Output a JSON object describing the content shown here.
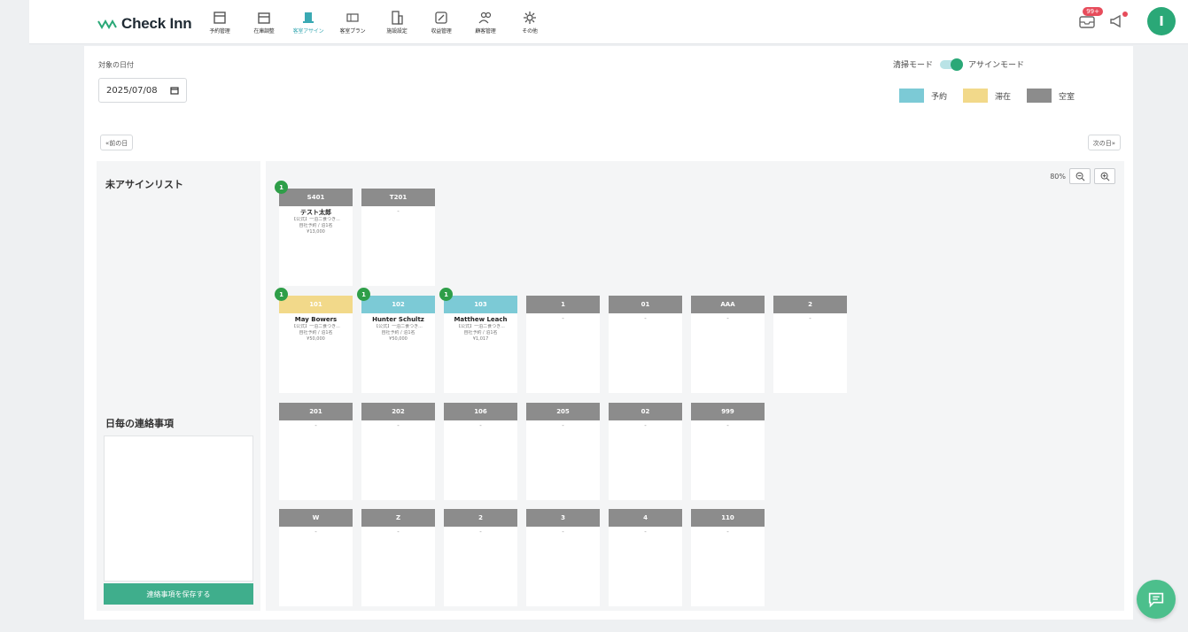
{
  "app": {
    "name": "Check Inn"
  },
  "nav": [
    {
      "label": "予約管理",
      "icon": "calendar-icon"
    },
    {
      "label": "在庫調整",
      "icon": "inventory-icon"
    },
    {
      "label": "客室アサイン",
      "icon": "room-assign-icon",
      "active": true
    },
    {
      "label": "客室プラン",
      "icon": "room-plan-icon"
    },
    {
      "label": "施設設定",
      "icon": "building-icon"
    },
    {
      "label": "収益管理",
      "icon": "revenue-icon"
    },
    {
      "label": "顧客管理",
      "icon": "customers-icon"
    },
    {
      "label": "その他",
      "icon": "gear-icon"
    }
  ],
  "header": {
    "notification_badge": "99+",
    "avatar_letter": "I"
  },
  "date": {
    "label": "対象の日付",
    "value": "2025/07/08"
  },
  "mode": {
    "left": "清掃モード",
    "right": "アサインモード"
  },
  "legend": [
    {
      "label": "予約",
      "color": "#7ccad6"
    },
    {
      "label": "滞在",
      "color": "#f2d98a"
    },
    {
      "label": "空室",
      "color": "#8c8c8c"
    }
  ],
  "nav_buttons": {
    "prev": "«前の日",
    "next": "次の日»"
  },
  "left_panel": {
    "unassigned_title": "未アサインリスト",
    "notes_title": "日毎の連絡事項",
    "save_button": "連絡事項を保存する"
  },
  "zoom": {
    "level": "80%"
  },
  "colors": {
    "reserved": "#7ccad6",
    "staying": "#f2d98a",
    "vacant": "#8c8c8c",
    "accent": "#2aa877"
  },
  "rooms": [
    [
      {
        "name": "S401",
        "status": "vacant",
        "count": "1",
        "guest": "テスト太郎",
        "l1": "【公式】一泊二食つき...",
        "l2": "自社予約 / 泊1名",
        "l3": "¥13,000"
      },
      {
        "name": "T201",
        "status": "vacant",
        "empty": "-"
      }
    ],
    [
      {
        "name": "101",
        "status": "staying",
        "count": "1",
        "guest": "May Bowers",
        "l1": "【公式】一泊二食つき...",
        "l2": "自社予約 / 泊1名",
        "l3": "¥50,000"
      },
      {
        "name": "102",
        "status": "reserved",
        "count": "1",
        "guest": "Hunter Schultz",
        "l1": "【公式】一泊二食つき...",
        "l2": "自社予約 / 泊1名",
        "l3": "¥50,000"
      },
      {
        "name": "103",
        "status": "reserved",
        "count": "1",
        "guest": "Matthew Leach",
        "l1": "【公式】一泊二食つき...",
        "l2": "自社予約 / 泊1名",
        "l3": "¥1,017"
      },
      {
        "name": "1",
        "status": "vacant",
        "empty": "-"
      },
      {
        "name": "01",
        "status": "vacant",
        "empty": "-"
      },
      {
        "name": "AAA",
        "status": "vacant",
        "empty": "-"
      },
      {
        "name": "2",
        "status": "vacant",
        "empty": "-"
      }
    ],
    [
      {
        "name": "201",
        "status": "vacant",
        "empty": "-"
      },
      {
        "name": "202",
        "status": "vacant",
        "empty": "-"
      },
      {
        "name": "106",
        "status": "vacant",
        "empty": "-"
      },
      {
        "name": "205",
        "status": "vacant",
        "empty": "-"
      },
      {
        "name": "02",
        "status": "vacant",
        "empty": "-"
      },
      {
        "name": "999",
        "status": "vacant",
        "empty": "-"
      }
    ],
    [
      {
        "name": "W",
        "status": "vacant",
        "empty": "-"
      },
      {
        "name": "Z",
        "status": "vacant",
        "empty": "-"
      },
      {
        "name": "2",
        "status": "vacant",
        "empty": "-"
      },
      {
        "name": "3",
        "status": "vacant",
        "empty": "-"
      },
      {
        "name": "4",
        "status": "vacant",
        "empty": "-"
      },
      {
        "name": "110",
        "status": "vacant",
        "empty": "-"
      }
    ]
  ]
}
